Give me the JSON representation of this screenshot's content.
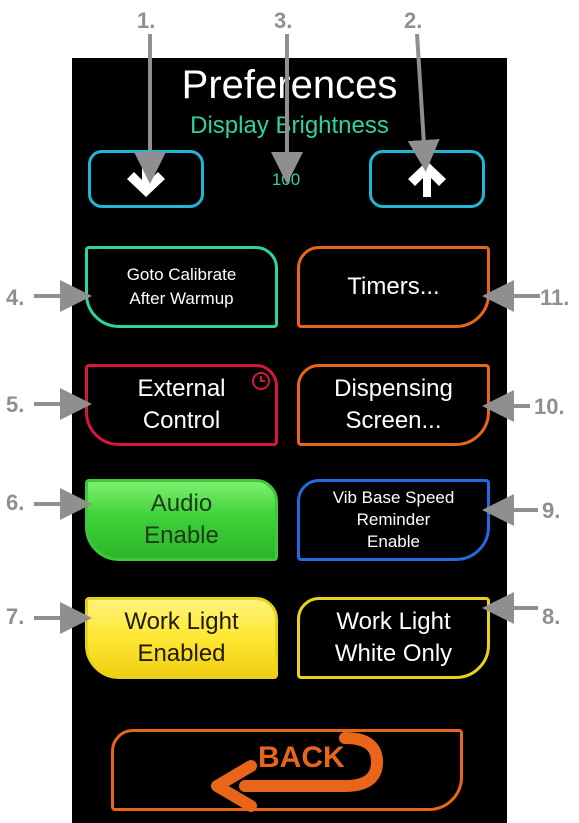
{
  "header": {
    "title": "Preferences",
    "subtitle": "Display Brightness",
    "brightness_value": "100"
  },
  "buttons": {
    "decrease": {
      "icon": "down-arrow-icon"
    },
    "increase": {
      "icon": "up-arrow-icon"
    },
    "goto_calibrate": {
      "line1": "Goto Calibrate",
      "line2": "After Warmup"
    },
    "timers": {
      "label": "Timers..."
    },
    "external_control": {
      "line1": "External",
      "line2": "Control",
      "icon": "clock-icon"
    },
    "dispensing_screen": {
      "line1": "Dispensing",
      "line2": "Screen..."
    },
    "audio_enable": {
      "line1": "Audio",
      "line2": "Enable"
    },
    "vib_base_speed": {
      "line1": "Vib Base Speed",
      "line2": "Reminder",
      "line3": "Enable"
    },
    "work_light_enabled": {
      "line1": "Work Light",
      "line2": "Enabled"
    },
    "work_light_white": {
      "line1": "Work Light",
      "line2": "White Only"
    },
    "back": {
      "label": "BACK",
      "icon": "back-arrow-icon"
    }
  },
  "callouts": {
    "c1": "1.",
    "c2": "2.",
    "c3": "3.",
    "c4": "4.",
    "c5": "5.",
    "c6": "6.",
    "c7": "7.",
    "c8": "8.",
    "c9": "9.",
    "c10": "10.",
    "c11": "11."
  },
  "colors": {
    "accent_teal": "#2dd4a0",
    "cyan": "#22b6d6",
    "orange": "#e8651a",
    "red": "#d6163e",
    "blue": "#1f6be0",
    "yellow": "#e8d21a",
    "green": "#3fc93a",
    "callout_gray": "#8f8f8f"
  }
}
